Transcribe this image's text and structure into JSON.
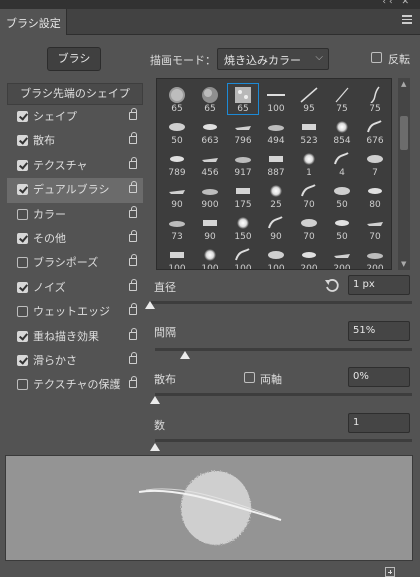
{
  "panel": {
    "tab_title": "ブラシ設定"
  },
  "toolbar": {
    "brush_button": "ブラシ",
    "mode_label": "描画モード：",
    "mode_value": "焼き込みカラー",
    "flip_label": "反転",
    "flip_checked": false
  },
  "options": {
    "header": "ブラシ先端のシェイプ",
    "items": [
      {
        "label": "シェイプ",
        "checked": true,
        "selected": false
      },
      {
        "label": "散布",
        "checked": true,
        "selected": false
      },
      {
        "label": "テクスチャ",
        "checked": true,
        "selected": false
      },
      {
        "label": "デュアルブラシ",
        "checked": true,
        "selected": true
      },
      {
        "label": "カラー",
        "checked": false,
        "selected": false
      },
      {
        "label": "その他",
        "checked": true,
        "selected": false
      },
      {
        "label": "ブラシポーズ",
        "checked": false,
        "selected": false
      },
      {
        "label": "ノイズ",
        "checked": true,
        "selected": false
      },
      {
        "label": "ウェットエッジ",
        "checked": false,
        "selected": false
      },
      {
        "label": "重ね描き効果",
        "checked": true,
        "selected": false
      },
      {
        "label": "滑らかさ",
        "checked": true,
        "selected": false
      },
      {
        "label": "テクスチャの保護",
        "checked": false,
        "selected": false
      }
    ]
  },
  "presets": {
    "selected_index": 2,
    "rows": [
      [
        "65",
        "65",
        "65",
        "100",
        "95",
        "75",
        "75"
      ],
      [
        "50",
        "663",
        "796",
        "494",
        "523",
        "854",
        "676"
      ],
      [
        "789",
        "456",
        "917",
        "887",
        "1",
        "4",
        "7"
      ],
      [
        "90",
        "900",
        "175",
        "25",
        "70",
        "50",
        "80"
      ],
      [
        "73",
        "90",
        "150",
        "90",
        "70",
        "50",
        "70"
      ],
      [
        "100",
        "100",
        "100",
        "100",
        "200",
        "200",
        "200"
      ]
    ]
  },
  "settings": {
    "diameter_label": "直径",
    "diameter_value": "1 px",
    "diameter_level": 0,
    "spacing_label": "間隔",
    "spacing_value": "51%",
    "spacing_level": 0.51,
    "scatter_label": "散布",
    "both_axes_label": "両軸",
    "scatter_value": "0%",
    "scatter_level": 0,
    "count_label": "数",
    "count_value": "1",
    "count_level": 0
  },
  "colors": {
    "accent": "#1d8ad6",
    "panel_bg": "#535353",
    "preview_bg": "#949494"
  }
}
